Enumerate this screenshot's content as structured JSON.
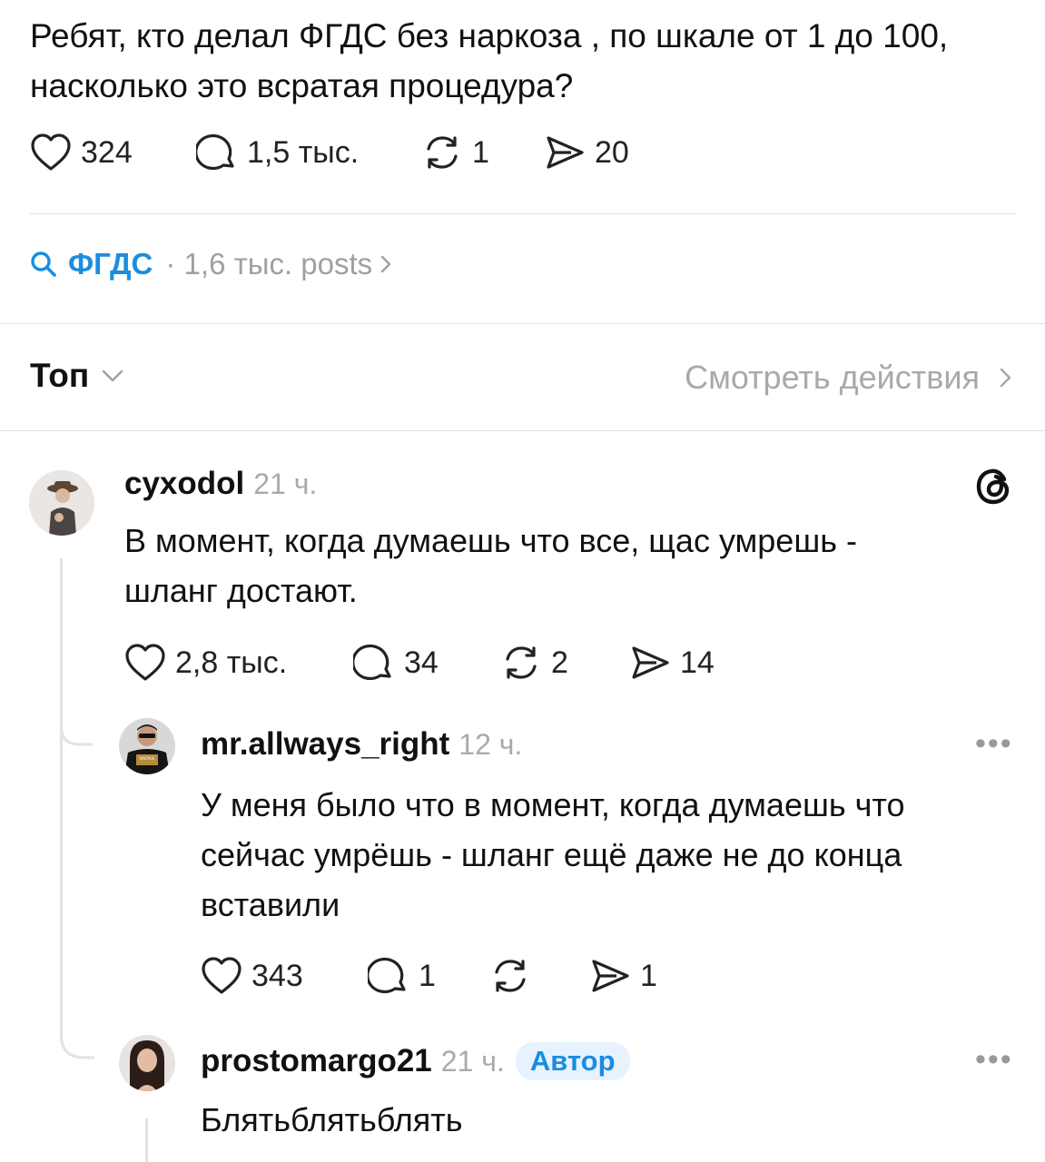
{
  "post": {
    "text": "Ребят, кто делал ФГДС без наркоза , по шкале от 1 до 100, насколько это всратая процедура?",
    "likes": "324",
    "replies": "1,5 тыс.",
    "reposts": "1",
    "shares": "20"
  },
  "topic": {
    "name": "ФГДС",
    "meta": "· 1,6 тыс. posts"
  },
  "sort": {
    "label": "Топ",
    "view_activity": "Смотреть действия"
  },
  "comments": [
    {
      "username": "cyxodol",
      "time": "21 ч.",
      "text_line1": "В момент, когда думаешь что все, щас умрешь -",
      "text_line2": "шланг достают.",
      "likes": "2,8 тыс.",
      "replies": "34",
      "reposts": "2",
      "shares": "14"
    },
    {
      "username": "mr.allways_right",
      "time": "12 ч.",
      "text_line1": "У меня было что в момент, когда думаешь что",
      "text_line2": "сейчас умрёшь - шланг ещё даже не до конца",
      "text_line3": "вставили",
      "likes": "343",
      "replies": "1",
      "reposts": "",
      "shares": "1",
      "avatar_text": "VINTAGE"
    },
    {
      "username": "prostomargo21",
      "time": "21 ч.",
      "badge": "Автор",
      "text": "Блятьблятьблять"
    }
  ],
  "icons": {
    "like": "heart-icon",
    "reply": "speech-bubble-icon",
    "repost": "repost-icon",
    "share": "send-icon",
    "search": "search-icon",
    "threads": "threads-logo-icon",
    "more": "more-dots-icon"
  },
  "colors": {
    "accent": "#1a8de0",
    "muted": "#a9a9a9",
    "divider": "#e2e2e2"
  }
}
